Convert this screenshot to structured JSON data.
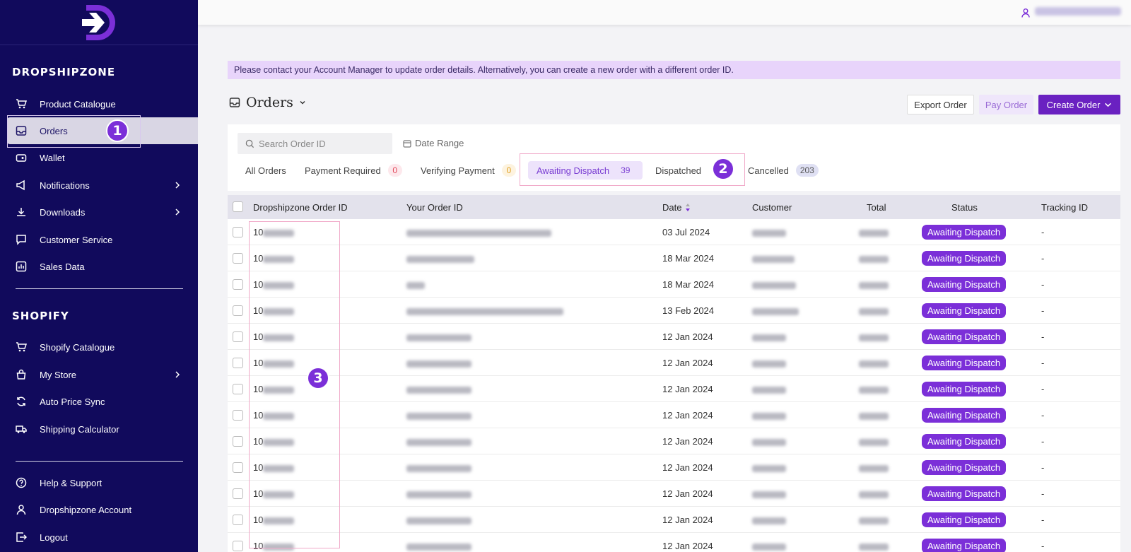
{
  "sidebar": {
    "sections": [
      {
        "title": "DROPSHIPZONE"
      },
      {
        "title": "SHOPIFY"
      }
    ],
    "items": [
      {
        "label": "Product Catalogue",
        "icon": "cart-icon"
      },
      {
        "label": "Orders",
        "icon": "inbox-icon"
      },
      {
        "label": "Wallet",
        "icon": "wallet-icon"
      },
      {
        "label": "Notifications",
        "icon": "megaphone-icon"
      },
      {
        "label": "Downloads",
        "icon": "download-icon"
      },
      {
        "label": "Customer Service",
        "icon": "chat-icon"
      },
      {
        "label": "Sales Data",
        "icon": "chart-icon"
      },
      {
        "label": "Shopify Catalogue",
        "icon": "cart-icon"
      },
      {
        "label": "My Store",
        "icon": "bag-icon"
      },
      {
        "label": "Auto Price Sync",
        "icon": "sync-icon"
      },
      {
        "label": "Shipping Calculator",
        "icon": "truck-icon"
      },
      {
        "label": "Help & Support",
        "icon": "help-icon"
      },
      {
        "label": "Dropshipzone Account",
        "icon": "user-icon"
      },
      {
        "label": "Logout",
        "icon": "logout-icon"
      }
    ]
  },
  "annotations": {
    "one": "1",
    "two": "2",
    "three": "3"
  },
  "notice": "Please contact your Account Manager to update order details. Alternatively, you can create a new order with a different order ID.",
  "header": {
    "title": "Orders",
    "export_label": "Export Order",
    "pay_label": "Pay Order",
    "create_label": "Create Order"
  },
  "filters": {
    "search_placeholder": "Search Order ID",
    "date_range": "Date Range",
    "tabs": [
      {
        "label": "All Orders"
      },
      {
        "label": "Payment Required",
        "count": "0"
      },
      {
        "label": "Verifying Payment",
        "count": "0"
      },
      {
        "label": "Awaiting Dispatch",
        "count": "39"
      },
      {
        "label": "Dispatched"
      },
      {
        "label": "Cancelled",
        "count": "203"
      }
    ]
  },
  "table": {
    "columns": [
      "Dropshipzone Order ID",
      "Your Order ID",
      "Date",
      "Customer",
      "Total",
      "Status",
      "Tracking ID"
    ],
    "rows": [
      {
        "id_prefix": "10",
        "date": "03 Jul 2024",
        "status": "Awaiting Dispatch",
        "tracking": "-"
      },
      {
        "id_prefix": "10",
        "date": "18 Mar 2024",
        "status": "Awaiting Dispatch",
        "tracking": "-"
      },
      {
        "id_prefix": "10",
        "date": "18 Mar 2024",
        "status": "Awaiting Dispatch",
        "tracking": "-"
      },
      {
        "id_prefix": "10",
        "date": "13 Feb 2024",
        "status": "Awaiting Dispatch",
        "tracking": "-"
      },
      {
        "id_prefix": "10",
        "date": "12 Jan 2024",
        "status": "Awaiting Dispatch",
        "tracking": "-"
      },
      {
        "id_prefix": "10",
        "date": "12 Jan 2024",
        "status": "Awaiting Dispatch",
        "tracking": "-"
      },
      {
        "id_prefix": "10",
        "date": "12 Jan 2024",
        "status": "Awaiting Dispatch",
        "tracking": "-"
      },
      {
        "id_prefix": "10",
        "date": "12 Jan 2024",
        "status": "Awaiting Dispatch",
        "tracking": "-"
      },
      {
        "id_prefix": "10",
        "date": "12 Jan 2024",
        "status": "Awaiting Dispatch",
        "tracking": "-"
      },
      {
        "id_prefix": "10",
        "date": "12 Jan 2024",
        "status": "Awaiting Dispatch",
        "tracking": "-"
      },
      {
        "id_prefix": "10",
        "date": "12 Jan 2024",
        "status": "Awaiting Dispatch",
        "tracking": "-"
      },
      {
        "id_prefix": "10",
        "date": "12 Jan 2024",
        "status": "Awaiting Dispatch",
        "tracking": "-"
      },
      {
        "id_prefix": "10",
        "date": "12 Jan 2024",
        "status": "Awaiting Dispatch",
        "tracking": "-"
      }
    ]
  },
  "colors": {
    "sidebar_bg": "#110a5c",
    "accent": "#7b2fd8",
    "button_primary": "#6a21c1"
  }
}
